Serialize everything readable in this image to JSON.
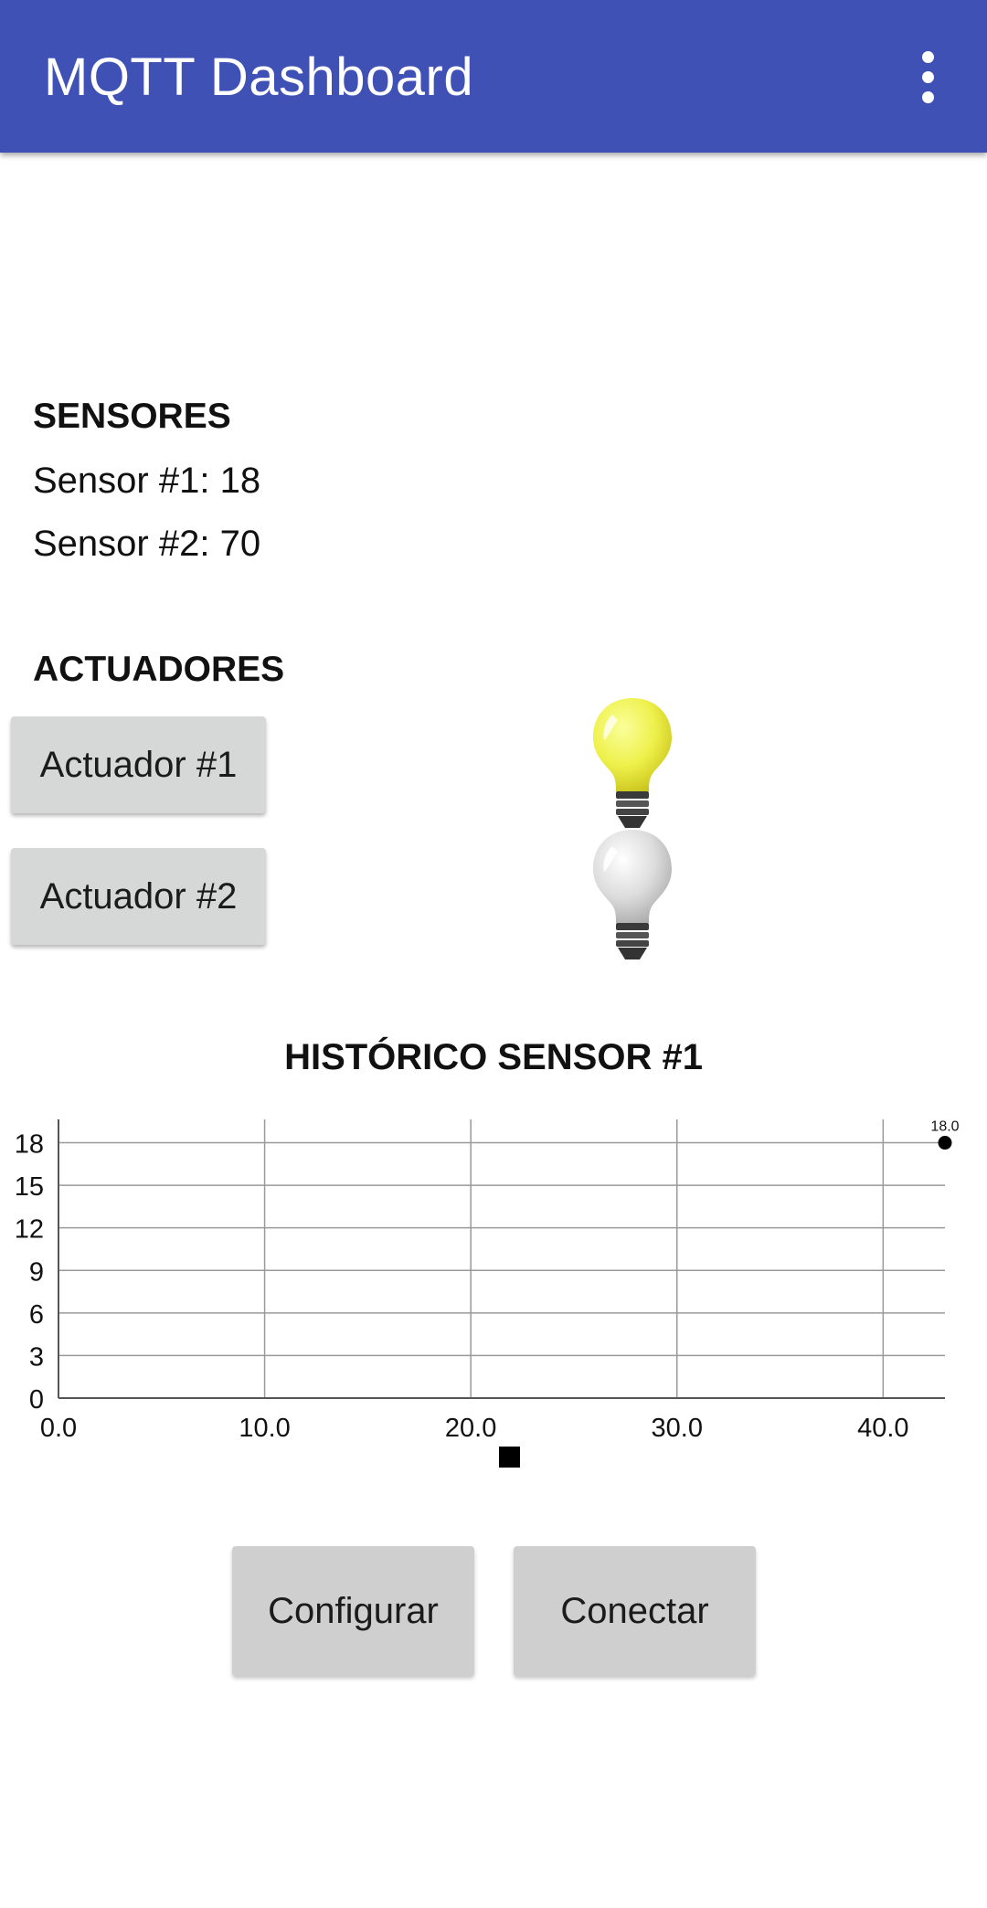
{
  "appbar": {
    "title": "MQTT Dashboard",
    "overflow_icon": "more-vert-icon",
    "color": "#3f51b5"
  },
  "sensors": {
    "heading": "SENSORES",
    "items": [
      {
        "label": "Sensor #1:",
        "value": "18"
      },
      {
        "label": "Sensor #2:",
        "value": "70"
      }
    ]
  },
  "actuators": {
    "heading": "ACTUADORES",
    "items": [
      {
        "label": "Actuador #1",
        "state": "on",
        "icon": "lightbulb-on-icon"
      },
      {
        "label": "Actuador #2",
        "state": "off",
        "icon": "lightbulb-off-icon"
      }
    ]
  },
  "chart": {
    "title": "HISTÓRICO SENSOR #1",
    "legend_marker": "square"
  },
  "chart_data": {
    "type": "line",
    "title": "HISTÓRICO SENSOR #1",
    "xlabel": "",
    "ylabel": "",
    "xlim": [
      0,
      43
    ],
    "ylim": [
      0,
      19
    ],
    "x_ticks": [
      "0.0",
      "10.0",
      "20.0",
      "30.0",
      "40.0"
    ],
    "y_ticks": [
      "0",
      "3",
      "6",
      "9",
      "12",
      "15",
      "18"
    ],
    "grid": true,
    "legend": "bottom-center",
    "series": [
      {
        "points": [
          {
            "x": 43,
            "y": 18
          }
        ],
        "point_labels": [
          "18.0"
        ],
        "color": "#000000"
      }
    ]
  },
  "buttons": {
    "configure": "Configurar",
    "connect": "Conectar"
  }
}
